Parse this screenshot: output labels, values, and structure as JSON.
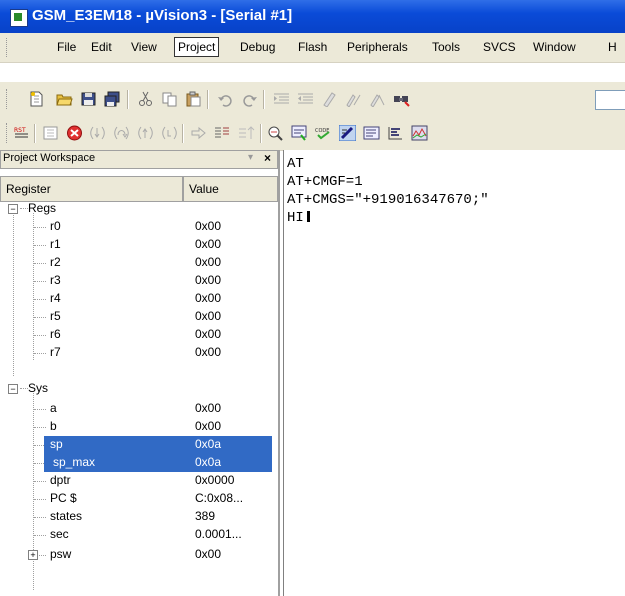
{
  "window": {
    "title": "GSM_E3EM18  - µVision3 - [Serial #1]"
  },
  "menubar": {
    "items": [
      "File",
      "Edit",
      "View",
      "Project",
      "Debug",
      "Flash",
      "Peripherals",
      "Tools",
      "SVCS",
      "Window",
      "H"
    ],
    "active": "Project"
  },
  "workspace": {
    "title": "Project Workspace",
    "columns": {
      "name": "Register",
      "value": "Value"
    },
    "groups": [
      {
        "label": "Regs",
        "expander": "−",
        "items": [
          {
            "name": "r0",
            "value": "0x00"
          },
          {
            "name": "r1",
            "value": "0x00"
          },
          {
            "name": "r2",
            "value": "0x00"
          },
          {
            "name": "r3",
            "value": "0x00"
          },
          {
            "name": "r4",
            "value": "0x00"
          },
          {
            "name": "r5",
            "value": "0x00"
          },
          {
            "name": "r6",
            "value": "0x00"
          },
          {
            "name": "r7",
            "value": "0x00"
          }
        ]
      },
      {
        "label": "Sys",
        "expander": "−",
        "items": [
          {
            "name": "a",
            "value": "0x00"
          },
          {
            "name": "b",
            "value": "0x00"
          },
          {
            "name": "sp",
            "value": "0x0a",
            "selected": true
          },
          {
            "name": "sp_max",
            "value": "0x0a",
            "selected": true
          },
          {
            "name": "dptr",
            "value": "0x0000"
          },
          {
            "name": "PC  $",
            "value": "C:0x08..."
          },
          {
            "name": "states",
            "value": "389"
          },
          {
            "name": "sec",
            "value": "0.0001..."
          },
          {
            "name": "psw",
            "value": "0x00",
            "expander": "+"
          }
        ]
      }
    ]
  },
  "serial": {
    "lines": [
      "AT",
      "AT+CMGF=1",
      "AT+CMGS=\"+919016347670;\"",
      "HI"
    ]
  }
}
